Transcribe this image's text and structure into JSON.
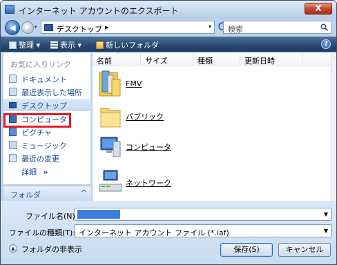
{
  "window": {
    "title": "インターネット アカウントのエクスポート",
    "close_label": "X"
  },
  "nav_buttons": {
    "back": "◀",
    "forward": "▶",
    "history": "▾"
  },
  "address": {
    "location": "デスクトップ",
    "chevron": "▸",
    "dropdown": "▾"
  },
  "search": {
    "placeholder": "検索"
  },
  "toolbar": {
    "organize": "整理",
    "views": "表示",
    "new_folder": "新しいフォルダ",
    "help": "?"
  },
  "sidebar": {
    "heading": "お気に入りリンク",
    "items": [
      {
        "label": "ドキュメント",
        "icon": "documents-icon"
      },
      {
        "label": "最近表示した場所",
        "icon": "recent-places-icon"
      },
      {
        "label": "デスクトップ",
        "icon": "desktop-icon"
      },
      {
        "label": "コンピュータ",
        "icon": "computer-icon"
      },
      {
        "label": "ピクチャ",
        "icon": "pictures-icon"
      },
      {
        "label": "ミュージック",
        "icon": "music-icon"
      },
      {
        "label": "最近の変更",
        "icon": "recently-changed-icon"
      }
    ],
    "more": "詳細",
    "more_chevron": "»",
    "folders": "フォルダ",
    "folders_chevron": "^"
  },
  "columns": [
    "名前",
    "サイズ",
    "種類",
    "更新日時"
  ],
  "files": [
    {
      "name": "FMV",
      "icon": "user-folder-icon"
    },
    {
      "name": "パブリック",
      "icon": "folder-icon"
    },
    {
      "name": "コンピュータ",
      "icon": "computer-icon"
    },
    {
      "name": "ネットワーク",
      "icon": "network-icon"
    }
  ],
  "form": {
    "filename_label": "ファイル名(N):",
    "filename_value": "",
    "filetype_label": "ファイルの種類(T):",
    "filetype_value": "インターネット アカウント ファイル (*.iaf)",
    "hide_folders": "フォルダの非表示",
    "save": "保存(S)",
    "cancel": "キャンセル"
  }
}
